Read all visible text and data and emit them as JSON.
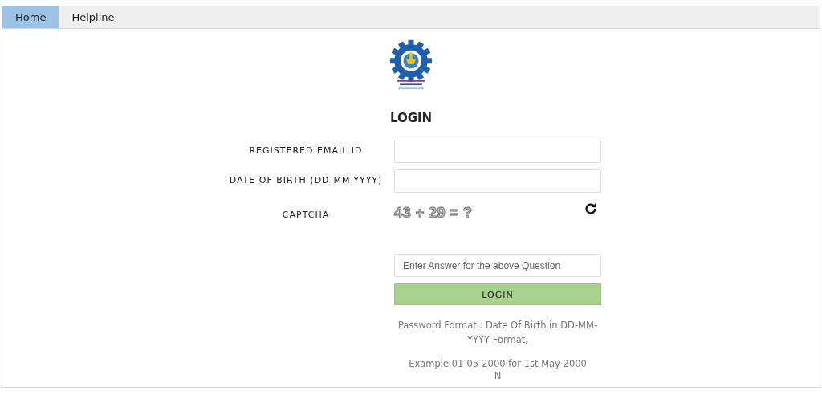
{
  "nav": {
    "tabs": [
      {
        "label": "Home",
        "selected": true
      },
      {
        "label": "Helpline",
        "selected": false
      }
    ]
  },
  "login": {
    "title": "LOGIN",
    "fields": [
      {
        "label": "REGISTERED EMAIL ID"
      },
      {
        "label": "DATE OF BIRTH (DD-MM-YYYY)"
      }
    ],
    "captcha": {
      "label": "CAPTCHA",
      "question": "43 + 29 = ?",
      "answer_placeholder": "Enter Answer for the above Question"
    },
    "button": "LOGIN",
    "notes": [
      "Password Format : Date Of Birth in DD-MM-YYYY Format,",
      "Example 01-05-2000 for 1st May 2000",
      "N"
    ]
  }
}
